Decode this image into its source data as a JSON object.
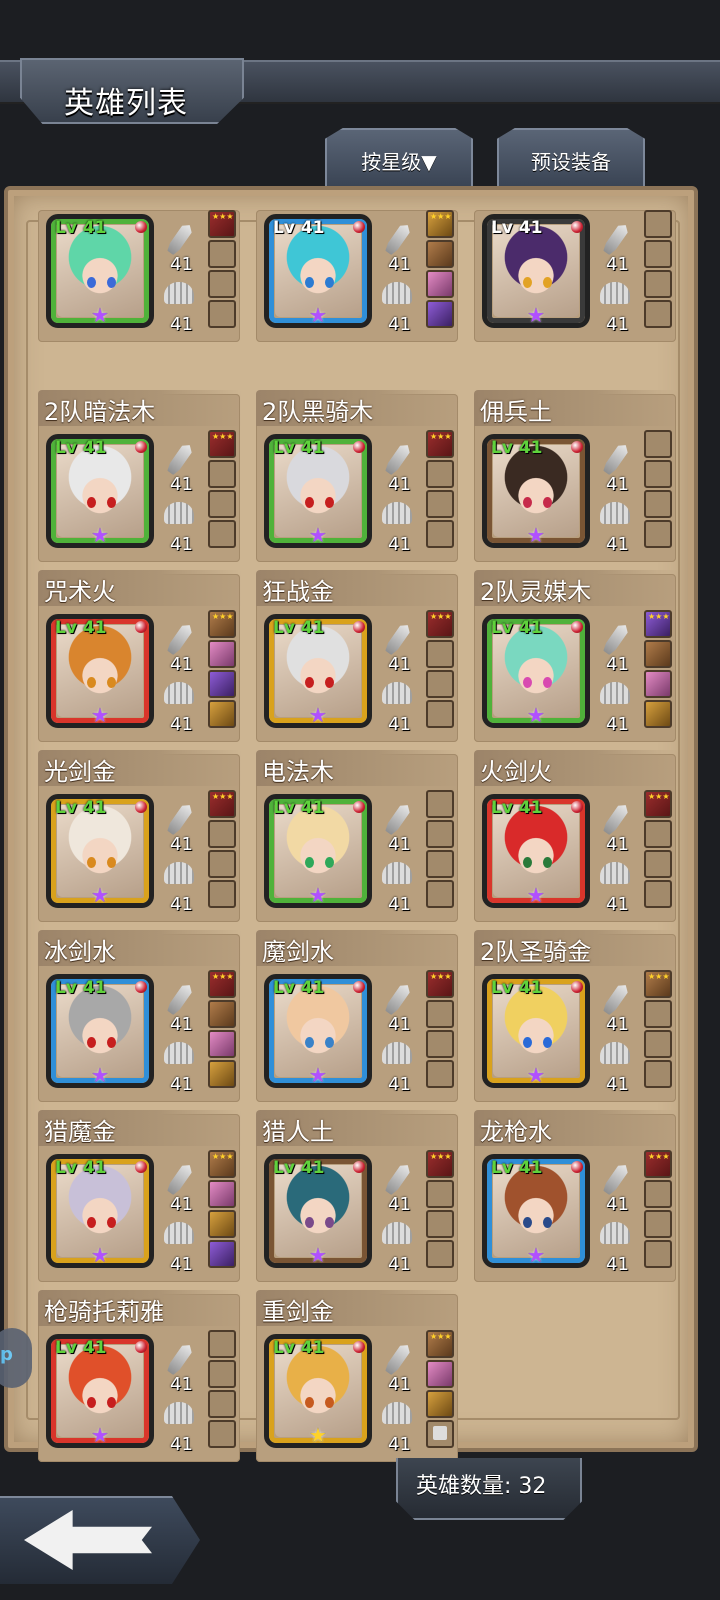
{
  "header": {
    "title": "英雄列表"
  },
  "tabs": {
    "sort_label": "按星级▼",
    "preset_label": "预设装备"
  },
  "footer": {
    "hero_count_label": "英雄数量: 32"
  },
  "side_bubble_text": "p",
  "colors": {
    "fire": "#d9352b",
    "wood": "#4fb23a",
    "water": "#2f8fd8",
    "gold": "#d9a21c",
    "earth": "#7a5534",
    "dark": "#3a3a3a"
  },
  "heroes": [
    {
      "name": "",
      "level": "Lv 41",
      "atk": "41",
      "def": "41",
      "frame": "wood",
      "star": "purple",
      "hair": "#5fd6a8",
      "eye": "#3b6ad8",
      "slots": [
        "item",
        "empty",
        "empty",
        "empty"
      ],
      "slot_colors": [
        "",
        "",
        "",
        ""
      ]
    },
    {
      "name": "",
      "level": "Lv 41",
      "atk": "41",
      "def": "41",
      "frame": "water",
      "star": "purple",
      "hair": "#3fc6d6",
      "eye": "#2c7bd2",
      "slots": [
        "item",
        "item",
        "item",
        "item"
      ],
      "slot_colors": [
        "gold",
        "brown",
        "pink",
        "violet"
      ]
    },
    {
      "name": "",
      "level": "Lv 41",
      "atk": "41",
      "def": "41",
      "frame": "dark",
      "star": "purple",
      "hair": "#4b2b6b",
      "eye": "#e2a224",
      "slots": [
        "empty",
        "empty",
        "empty",
        "empty"
      ],
      "slot_colors": [
        "",
        "",
        "",
        ""
      ]
    },
    {
      "name": "2队暗法木",
      "level": "Lv 41",
      "atk": "41",
      "def": "41",
      "frame": "wood",
      "star": "purple",
      "hair": "#e8e8e8",
      "eye": "#c61f1f",
      "slots": [
        "item",
        "empty",
        "empty",
        "empty"
      ],
      "slot_colors": [
        "",
        "",
        "",
        ""
      ]
    },
    {
      "name": "2队黑骑木",
      "level": "Lv 41",
      "atk": "41",
      "def": "41",
      "frame": "wood",
      "star": "purple",
      "hair": "#d9d9dd",
      "eye": "#c61f1f",
      "slots": [
        "item",
        "empty",
        "empty",
        "empty"
      ],
      "slot_colors": [
        "",
        "",
        "",
        ""
      ]
    },
    {
      "name": "佣兵土",
      "level": "Lv 41",
      "atk": "41",
      "def": "41",
      "frame": "earth",
      "star": "purple",
      "hair": "#3a2a22",
      "eye": "#c62a4a",
      "slots": [
        "empty",
        "empty",
        "empty",
        "empty"
      ],
      "slot_colors": [
        "",
        "",
        "",
        ""
      ]
    },
    {
      "name": "咒术火",
      "level": "Lv 41",
      "atk": "41",
      "def": "41",
      "frame": "fire",
      "star": "purple",
      "hair": "#d9852e",
      "eye": "#d98a1f",
      "slots": [
        "item",
        "item",
        "item",
        "item"
      ],
      "slot_colors": [
        "brown",
        "pink",
        "violet",
        "gold"
      ]
    },
    {
      "name": "狂战金",
      "level": "Lv 41",
      "atk": "41",
      "def": "41",
      "frame": "gold",
      "star": "purple",
      "hair": "#e0e0e0",
      "eye": "#c61f1f",
      "slots": [
        "item",
        "empty",
        "empty",
        "empty"
      ],
      "slot_colors": [
        "",
        "",
        "",
        ""
      ]
    },
    {
      "name": "2队灵媒木",
      "level": "Lv 41",
      "atk": "41",
      "def": "41",
      "frame": "wood",
      "star": "purple",
      "hair": "#7ad8c0",
      "eye": "#d84ab0",
      "slots": [
        "item",
        "item",
        "item",
        "item"
      ],
      "slot_colors": [
        "violet",
        "brown",
        "pink",
        "gold"
      ]
    },
    {
      "name": "光剑金",
      "level": "Lv 41",
      "atk": "41",
      "def": "41",
      "frame": "gold",
      "star": "purple",
      "hair": "#efe7dc",
      "eye": "#d98a1f",
      "slots": [
        "item",
        "empty",
        "empty",
        "empty"
      ],
      "slot_colors": [
        "",
        "",
        "",
        ""
      ]
    },
    {
      "name": "电法木",
      "level": "Lv 41",
      "atk": "41",
      "def": "41",
      "frame": "wood",
      "star": "purple",
      "hair": "#f2d9a4",
      "eye": "#2fa85a",
      "slots": [
        "empty",
        "empty",
        "empty",
        "empty"
      ],
      "slot_colors": [
        "",
        "",
        "",
        ""
      ]
    },
    {
      "name": "火剑火",
      "level": "Lv 41",
      "atk": "41",
      "def": "41",
      "frame": "fire",
      "star": "purple",
      "hair": "#d92a2a",
      "eye": "#2a7a3a",
      "slots": [
        "item",
        "empty",
        "empty",
        "empty"
      ],
      "slot_colors": [
        "",
        "",
        "",
        ""
      ]
    },
    {
      "name": "冰剑水",
      "level": "Lv 41",
      "atk": "41",
      "def": "41",
      "frame": "water",
      "star": "purple",
      "hair": "#a8a8a8",
      "eye": "#c61f1f",
      "slots": [
        "item",
        "item",
        "item",
        "item"
      ],
      "slot_colors": [
        "",
        "brown",
        "pink",
        "gold"
      ]
    },
    {
      "name": "魔剑水",
      "level": "Lv 41",
      "atk": "41",
      "def": "41",
      "frame": "water",
      "star": "purple",
      "hair": "#f0c8a0",
      "eye": "#3a82c8",
      "slots": [
        "item",
        "empty",
        "empty",
        "empty"
      ],
      "slot_colors": [
        "",
        "",
        "",
        ""
      ]
    },
    {
      "name": "2队圣骑金",
      "level": "Lv 41",
      "atk": "41",
      "def": "41",
      "frame": "gold",
      "star": "purple",
      "hair": "#f0d060",
      "eye": "#2a6ad8",
      "slots": [
        "item",
        "empty",
        "empty",
        "empty"
      ],
      "slot_colors": [
        "brown",
        "",
        "",
        ""
      ]
    },
    {
      "name": "猎魔金",
      "level": "Lv 41",
      "atk": "41",
      "def": "41",
      "frame": "gold",
      "star": "purple",
      "hair": "#c8c0d8",
      "eye": "#c61f1f",
      "slots": [
        "item",
        "item",
        "item",
        "item"
      ],
      "slot_colors": [
        "brown",
        "pink",
        "gold",
        "violet"
      ]
    },
    {
      "name": "猎人土",
      "level": "Lv 41",
      "atk": "41",
      "def": "41",
      "frame": "earth",
      "star": "purple",
      "hair": "#2a6a7a",
      "eye": "#7a4a8a",
      "slots": [
        "item",
        "empty",
        "empty",
        "empty"
      ],
      "slot_colors": [
        "",
        "",
        "",
        ""
      ]
    },
    {
      "name": "龙枪水",
      "level": "Lv 41",
      "atk": "41",
      "def": "41",
      "frame": "water",
      "star": "purple",
      "hair": "#a0522d",
      "eye": "#2a4a8a",
      "slots": [
        "item",
        "empty",
        "empty",
        "empty"
      ],
      "slot_colors": [
        "",
        "",
        "",
        ""
      ]
    },
    {
      "name": "枪骑托莉雅",
      "level": "Lv 41",
      "atk": "41",
      "def": "41",
      "frame": "fire",
      "star": "purple",
      "hair": "#e0502a",
      "eye": "#c61f1f",
      "slots": [
        "empty",
        "empty",
        "empty",
        "empty"
      ],
      "slot_colors": [
        "",
        "",
        "",
        ""
      ]
    },
    {
      "name": "重剑金",
      "level": "Lv 41",
      "atk": "41",
      "def": "41",
      "frame": "gold",
      "star": "gold",
      "hair": "#e8b048",
      "eye": "#c65a1f",
      "slots": [
        "item",
        "item",
        "item",
        "lock"
      ],
      "slot_colors": [
        "brown",
        "pink",
        "gold",
        ""
      ]
    }
  ]
}
